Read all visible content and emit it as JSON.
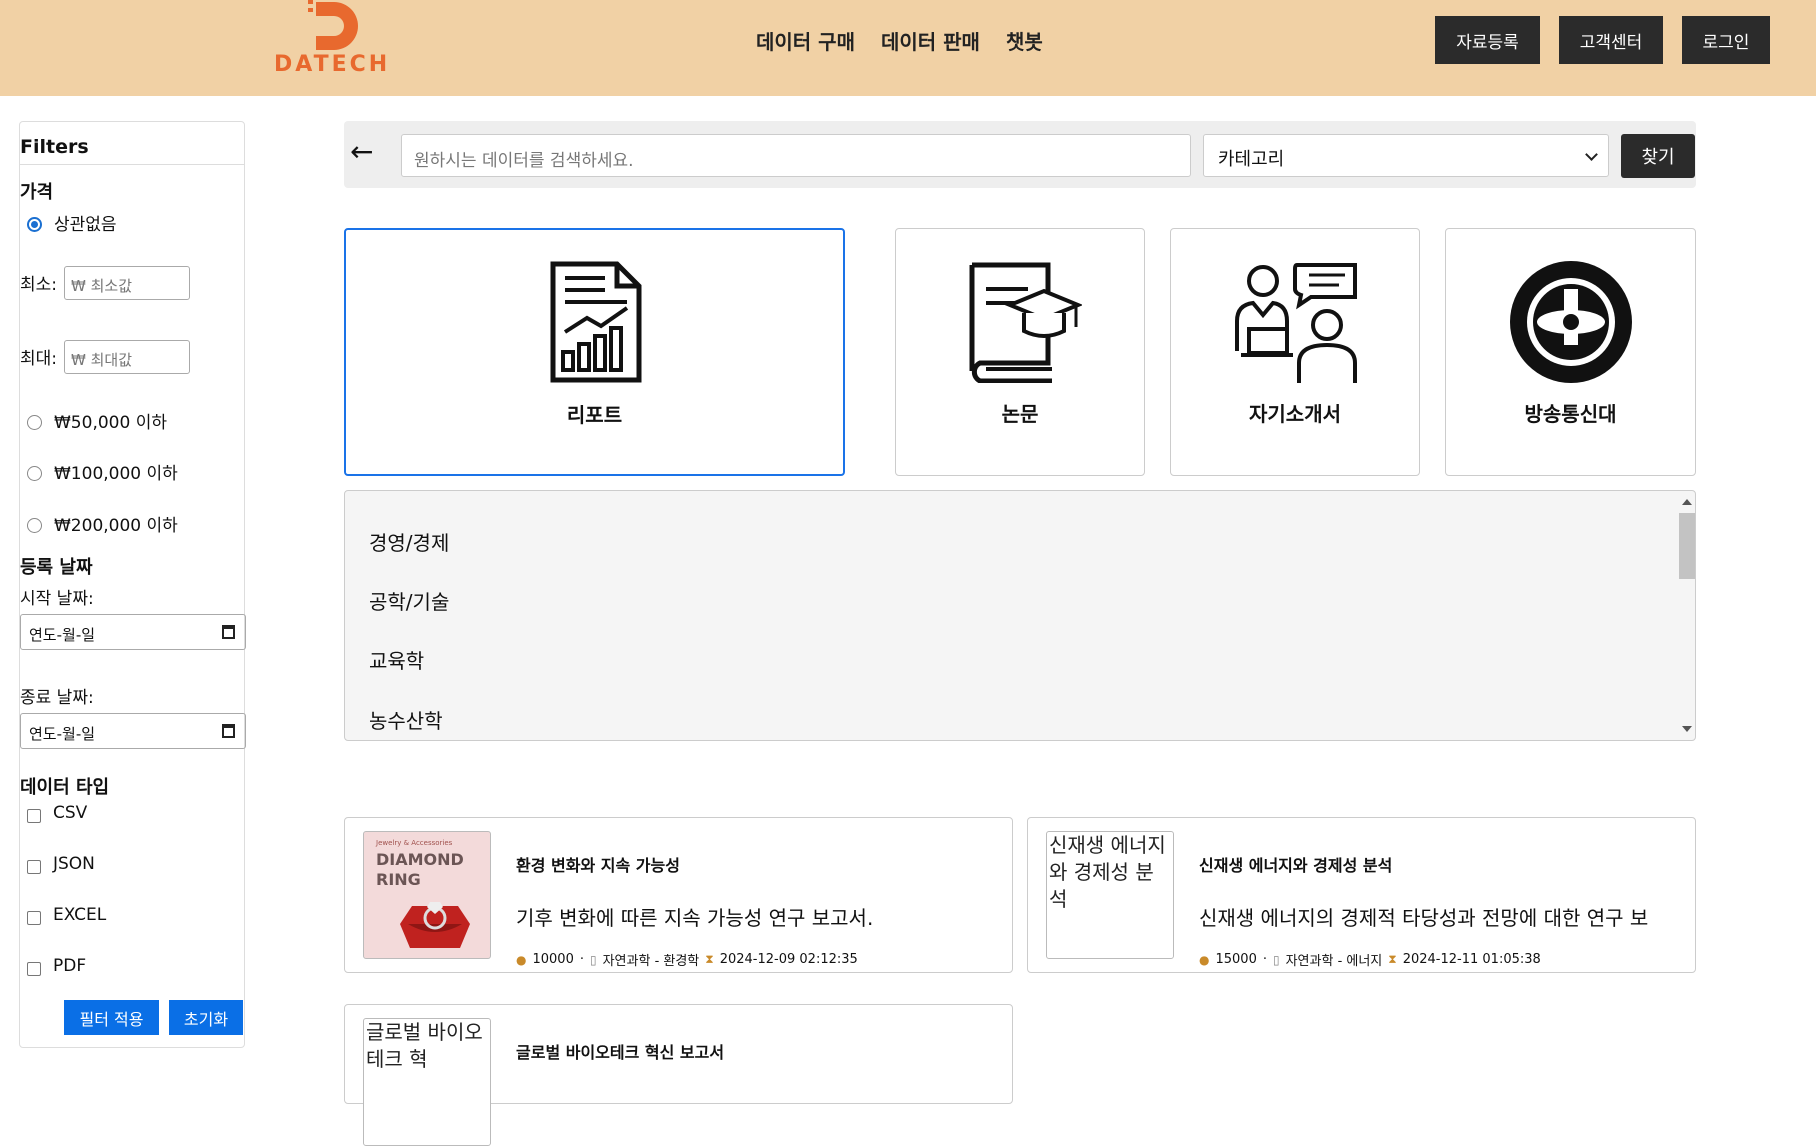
{
  "header": {
    "logo_text": "DATECH",
    "nav": [
      "데이터 구매",
      "데이터 판매",
      "챗봇"
    ],
    "buttons": {
      "register": "자료등록",
      "support": "고객센터",
      "login": "로그인"
    }
  },
  "sidebar": {
    "title": "Filters",
    "price_heading": "가격",
    "price_any": "상관없음",
    "min_label": "최소:",
    "min_placeholder": "₩ 최소값",
    "max_label": "최대:",
    "max_placeholder": "₩ 최대값",
    "price_options": [
      "₩50,000 이하",
      "₩100,000 이하",
      "₩200,000 이하"
    ],
    "date_heading": "등록 날짜",
    "start_label": "시작 날짜:",
    "end_label": "종료 날짜:",
    "date_placeholder": "연도-월-일",
    "type_heading": "데이터 타입",
    "types": [
      "CSV",
      "JSON",
      "EXCEL",
      "PDF"
    ],
    "apply": "필터 적용",
    "reset": "초기화"
  },
  "search": {
    "back": "←",
    "placeholder": "원하시는 데이터를 검색하세요.",
    "category_selected": "카테고리",
    "find": "찾기"
  },
  "categories": [
    {
      "label": "리포트",
      "icon": "report-chart-icon",
      "selected": true
    },
    {
      "label": "논문",
      "icon": "thesis-book-icon",
      "selected": false
    },
    {
      "label": "자기소개서",
      "icon": "interview-icon",
      "selected": false
    },
    {
      "label": "방송통신대",
      "icon": "university-seal-icon",
      "selected": false
    }
  ],
  "subcategories": [
    "경영/경제",
    "공학/기술",
    "교육학",
    "농수산학"
  ],
  "cards": [
    {
      "title": "환경 변화와 지속 가능성",
      "desc": "기후 변화에 따른 지속 가능성 연구 보고서.",
      "price": "10000",
      "category": "자연과학 - 환경학",
      "date": "2024-12-09 02:12:35",
      "thumb_small": "Jewelry & Accessories",
      "thumb_big": "DIAMOND RING"
    },
    {
      "title": "신재생 에너지와 경제성 분석",
      "desc": "신재생 에너지의 경제적 타당성과 전망에 대한 연구 보",
      "price": "15000",
      "category": "자연과학 - 에너지",
      "date": "2024-12-11 01:05:38",
      "thumb_alt": "신재생 에너지와 경제성 분석"
    },
    {
      "title": "글로벌 바이오테크 혁신 보고서",
      "thumb_alt": "글로벌 바이오테크 혁"
    }
  ],
  "colors": {
    "header_bg": "#f1d1a5",
    "accent": "#e8692e",
    "primary": "#0a6fe6",
    "dark": "#2b2b2b"
  }
}
